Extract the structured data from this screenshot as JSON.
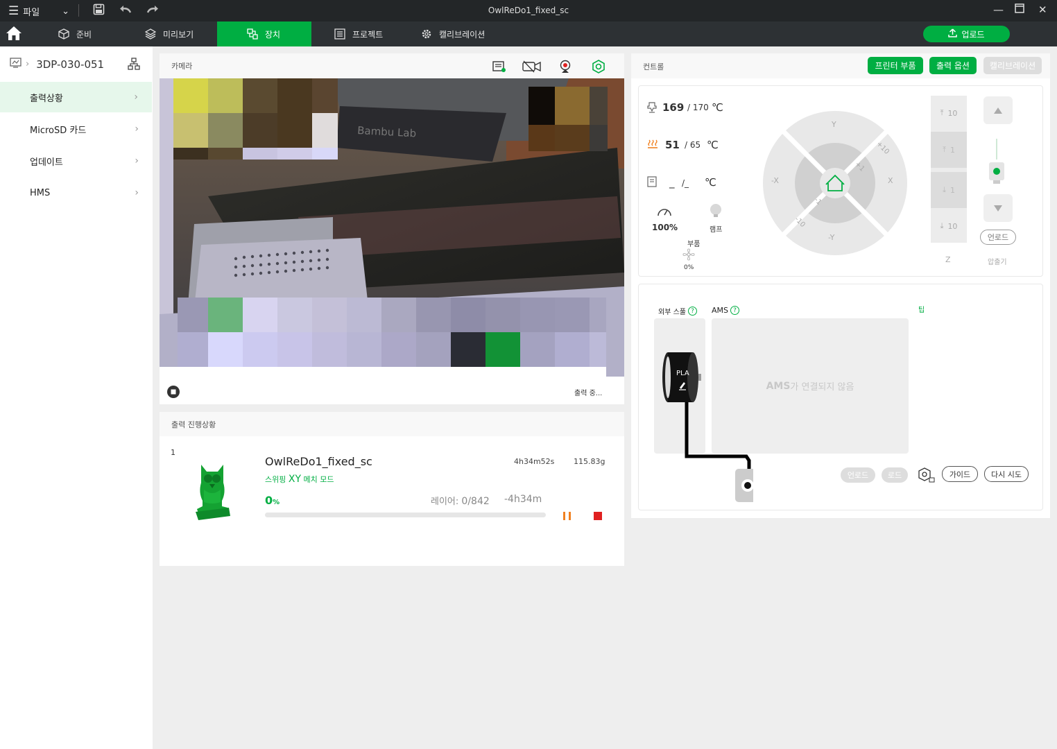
{
  "titlebar": {
    "file_menu": "파일",
    "title": "OwlReDo1_fixed_sc"
  },
  "nav": {
    "tabs": [
      {
        "label": "준비"
      },
      {
        "label": "미리보기"
      },
      {
        "label": "장치"
      },
      {
        "label": "프로젝트"
      },
      {
        "label": "캘리브레이션"
      }
    ],
    "upload": "업로드",
    "accent": "#00ae42"
  },
  "sidebar": {
    "device": "3DP-030-051",
    "items": [
      {
        "label": "출력상황"
      },
      {
        "label": "MicroSD 카드"
      },
      {
        "label": "업데이트"
      },
      {
        "label": "HMS"
      }
    ]
  },
  "camera": {
    "title": "카메라",
    "status": "출력 중..."
  },
  "progress": {
    "title": "출력 진행상황",
    "plate": "1",
    "file": "OwlReDo1_fixed_sc",
    "duration": "4h34m52s",
    "weight": "115.83g",
    "mode_prefix": "스위핑 ",
    "mode_xy": "XY",
    "mode_suffix": " 메치 모드",
    "percent": "0",
    "percent_unit": "%",
    "layer_label": "레이어: ",
    "layer_value": "0/842",
    "remaining": "-4h34m",
    "fraction": 0.0
  },
  "control": {
    "title": "컨트롤",
    "btn_parts": "프린터 부품",
    "btn_options": "출력 옵션",
    "btn_calib": "캘리브레이션",
    "nozzle_cur": "169",
    "nozzle_target": "/ 170",
    "bed_cur": "51",
    "bed_target": "/ 65",
    "chamber_cur": "_",
    "chamber_target": "/_",
    "unit": "℃",
    "speed": "100%",
    "lamp": "램프",
    "fan_label": "부품",
    "fan_value": "0%",
    "jog": {
      "y": "Y",
      "ny": "-Y",
      "x": "X",
      "nx": "-X",
      "p10": "+10",
      "p1": "+1",
      "n1": "-1",
      "n10": "-10"
    },
    "z_values": [
      "10",
      "1",
      "1",
      "10"
    ],
    "z_label": "Z",
    "unload": "언로드",
    "extruder": "압출기"
  },
  "ams": {
    "ext_spool": "외부 스풀",
    "ams_label": "AMS",
    "help": "?",
    "tip": "팁",
    "filament": "PLA",
    "not_connected_bold": "AMS",
    "not_connected_rest": "가 연결되지 않음",
    "btn_unload": "언로드",
    "btn_load": "로드",
    "btn_guide": "가이드",
    "btn_retry": "다시 시도"
  }
}
